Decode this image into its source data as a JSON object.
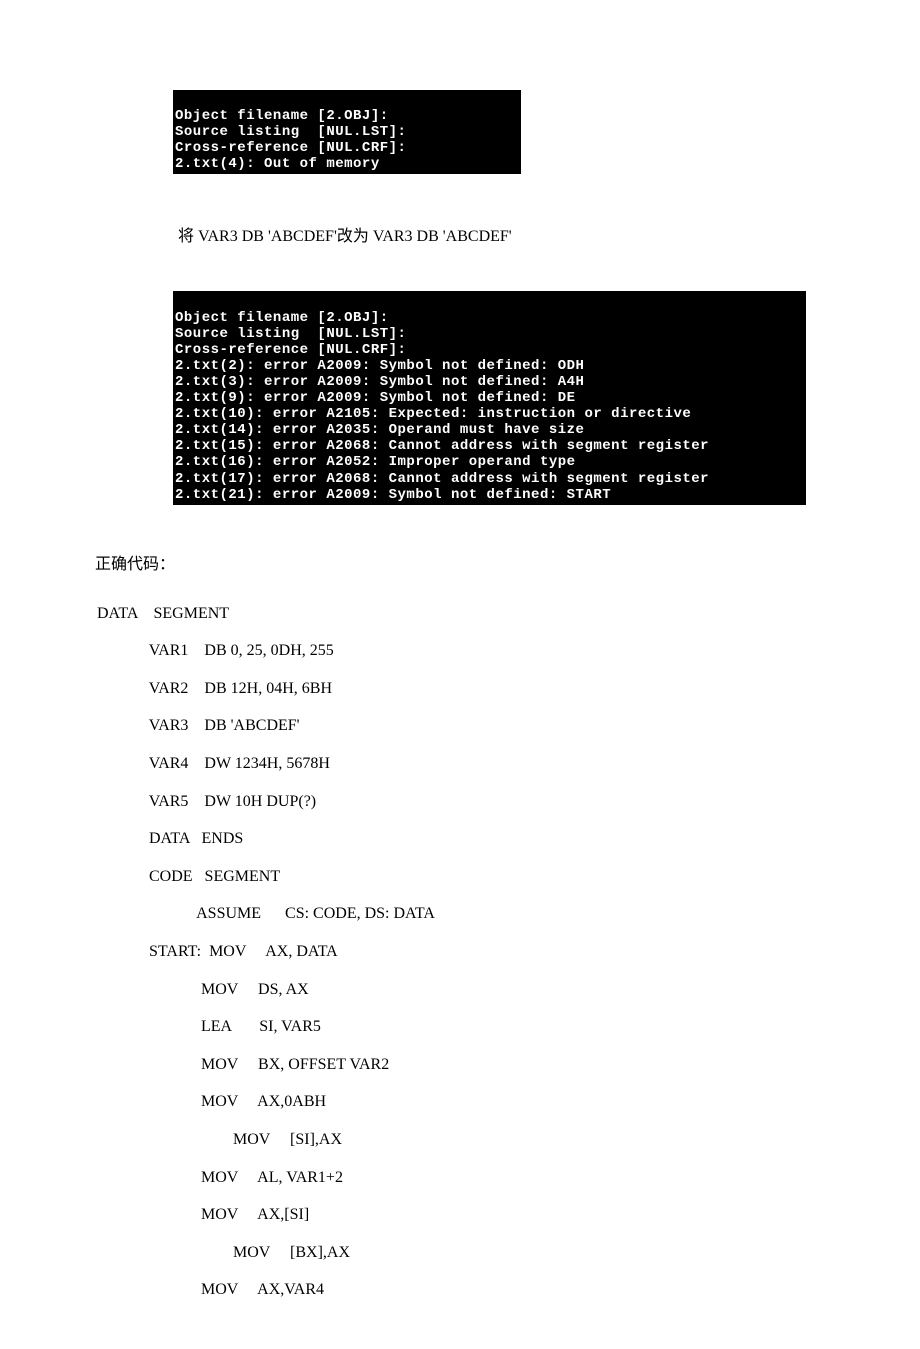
{
  "terminal1": {
    "line1": "Object filename [2.OBJ]:",
    "line2": "Source listing  [NUL.LST]:",
    "line3": "Cross-reference [NUL.CRF]:",
    "line4": "2.txt(4): Out of memory"
  },
  "note1": "将 VAR3     DB 'ABCDEF'改为 VAR3   DB 'ABCDEF'",
  "terminal2": {
    "line1": "Object filename [2.OBJ]:",
    "line2": "Source listing  [NUL.LST]:",
    "line3": "Cross-reference [NUL.CRF]:",
    "line4": "2.txt(2): error A2009: Symbol not defined: ODH",
    "line5": "2.txt(3): error A2009: Symbol not defined: A4H",
    "line6": "2.txt(9): error A2009: Symbol not defined: DE",
    "line7": "2.txt(10): error A2105: Expected: instruction or directive",
    "line8": "2.txt(14): error A2035: Operand must have size",
    "line9": "2.txt(15): error A2068: Cannot address with segment register",
    "line10": "2.txt(16): error A2052: Improper operand type",
    "line11": "2.txt(17): error A2068: Cannot address with segment register",
    "line12": "2.txt(21): error A2009: Symbol not defined: START"
  },
  "sectionHeader": "正确代码：",
  "code": {
    "l1": "DATA    SEGMENT",
    "l2": "             VAR1    DB 0, 25, 0DH, 255",
    "l3": "             VAR2    DB 12H, 04H, 6BH",
    "l4": "             VAR3    DB 'ABCDEF'",
    "l5": "             VAR4    DW 1234H, 5678H",
    "l6": "             VAR5    DW 10H DUP(?)",
    "l7": "             DATA   ENDS",
    "l8": "             CODE   SEGMENT",
    "l9": "                         ASSUME      CS: CODE, DS: DATA",
    "l10": "             START:  MOV     AX, DATA",
    "l11": "                          MOV     DS, AX",
    "l12": "                          LEA       SI, VAR5",
    "l13": "                          MOV     BX, OFFSET VAR2",
    "l14": "                          MOV     AX,0ABH",
    "l15": "                                  MOV     [SI],AX",
    "l16": "                          MOV     AL, VAR1+2",
    "l17": "                          MOV     AX,[SI]",
    "l18": "                                  MOV     [BX],AX",
    "l19": "                          MOV     AX,VAR4"
  }
}
